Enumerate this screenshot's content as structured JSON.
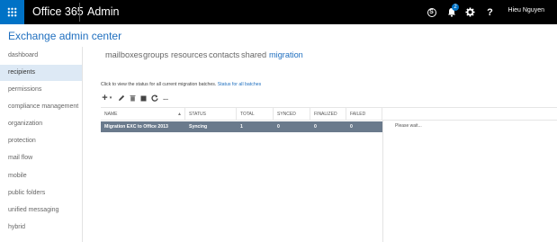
{
  "topbar": {
    "brand": "Office 365",
    "app": "Admin",
    "notification_count": "2",
    "help_label": "?",
    "user": "Hieu Nguyen"
  },
  "page_title": "Exchange admin center",
  "nav": {
    "items": [
      {
        "label": "dashboard",
        "selected": false
      },
      {
        "label": "recipients",
        "selected": true
      },
      {
        "label": "permissions",
        "selected": false
      },
      {
        "label": "compliance management",
        "selected": false
      },
      {
        "label": "organization",
        "selected": false
      },
      {
        "label": "protection",
        "selected": false
      },
      {
        "label": "mail flow",
        "selected": false
      },
      {
        "label": "mobile",
        "selected": false
      },
      {
        "label": "public folders",
        "selected": false
      },
      {
        "label": "unified messaging",
        "selected": false
      },
      {
        "label": "hybrid",
        "selected": false
      }
    ]
  },
  "tabs": [
    {
      "label": "mailboxes",
      "active": false
    },
    {
      "label": "groups",
      "active": false
    },
    {
      "label": "resources",
      "active": false
    },
    {
      "label": "contacts",
      "active": false
    },
    {
      "label": "shared",
      "active": false
    },
    {
      "label": "migration",
      "active": true
    }
  ],
  "info": {
    "text": "Click to view the status for all current migration batches.",
    "link": "Status for all batches"
  },
  "toolbar": {
    "icons": [
      "plus-icon",
      "chevron-down-icon",
      "pencil-icon",
      "trash-icon",
      "stop-icon",
      "refresh-icon",
      "more-icon"
    ],
    "more_label": "..."
  },
  "table": {
    "columns": [
      "NAME",
      "STATUS",
      "TOTAL",
      "SYNCED",
      "FINALIZED",
      "FAILED"
    ],
    "rows": [
      {
        "name": "Migration EXC to Office 2013",
        "status": "Syncing",
        "total": "1",
        "synced": "0",
        "finalized": "0",
        "failed": "0"
      }
    ]
  },
  "detail": {
    "text": "Please wait..."
  },
  "colors": {
    "topbar": "#000000",
    "waffle": "#0072c6",
    "accent": "#1f6fbf",
    "selected_nav": "#dde9f5",
    "selected_row": "#6a7a8c"
  }
}
